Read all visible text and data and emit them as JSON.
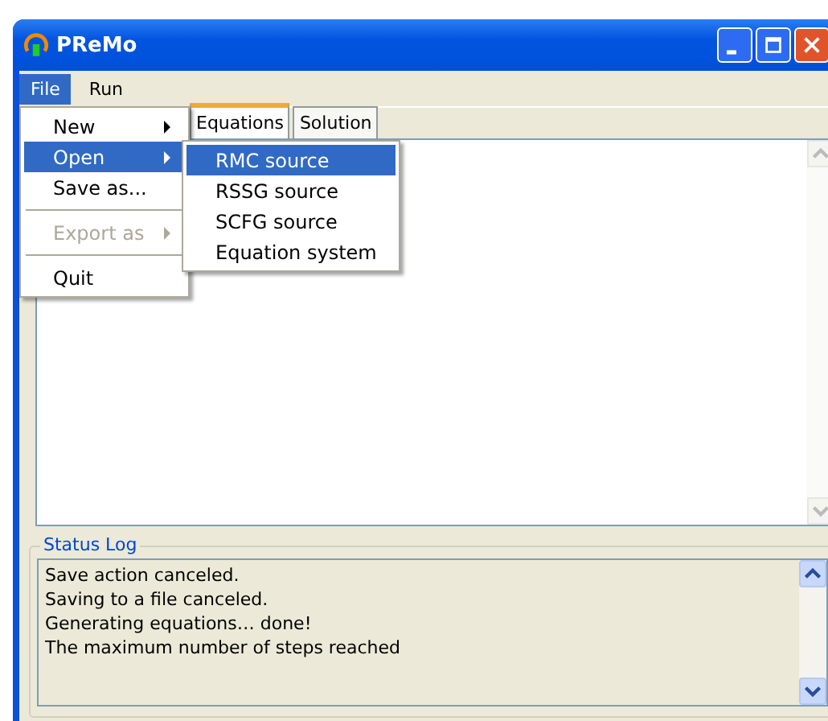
{
  "window": {
    "title": "PReMo"
  },
  "menu_bar": [
    {
      "label": "File",
      "selected": true
    },
    {
      "label": "Run",
      "selected": false
    }
  ],
  "tabs": [
    {
      "label": "Equations",
      "selected": true
    },
    {
      "label": "Solution",
      "selected": false
    }
  ],
  "file_menu": [
    {
      "kind": "item",
      "label": "New",
      "submenu": true,
      "selected": false,
      "disabled": false
    },
    {
      "kind": "item",
      "label": "Open",
      "submenu": true,
      "selected": true,
      "disabled": false
    },
    {
      "kind": "item",
      "label": "Save as...",
      "submenu": false,
      "selected": false,
      "disabled": false
    },
    {
      "kind": "separator"
    },
    {
      "kind": "item",
      "label": "Export as",
      "submenu": true,
      "selected": false,
      "disabled": true
    },
    {
      "kind": "separator"
    },
    {
      "kind": "item",
      "label": "Quit",
      "submenu": false,
      "selected": false,
      "disabled": false
    }
  ],
  "open_submenu": [
    {
      "label": "RMC source",
      "selected": true
    },
    {
      "label": "RSSG source",
      "selected": false
    },
    {
      "label": "SCFG source",
      "selected": false
    },
    {
      "label": "Equation system",
      "selected": false
    }
  ],
  "status_log": {
    "title": "Status Log",
    "lines": [
      "Save action canceled.",
      "Saving to a file canceled.",
      "Generating equations… done!",
      "The maximum number of steps reached"
    ]
  }
}
